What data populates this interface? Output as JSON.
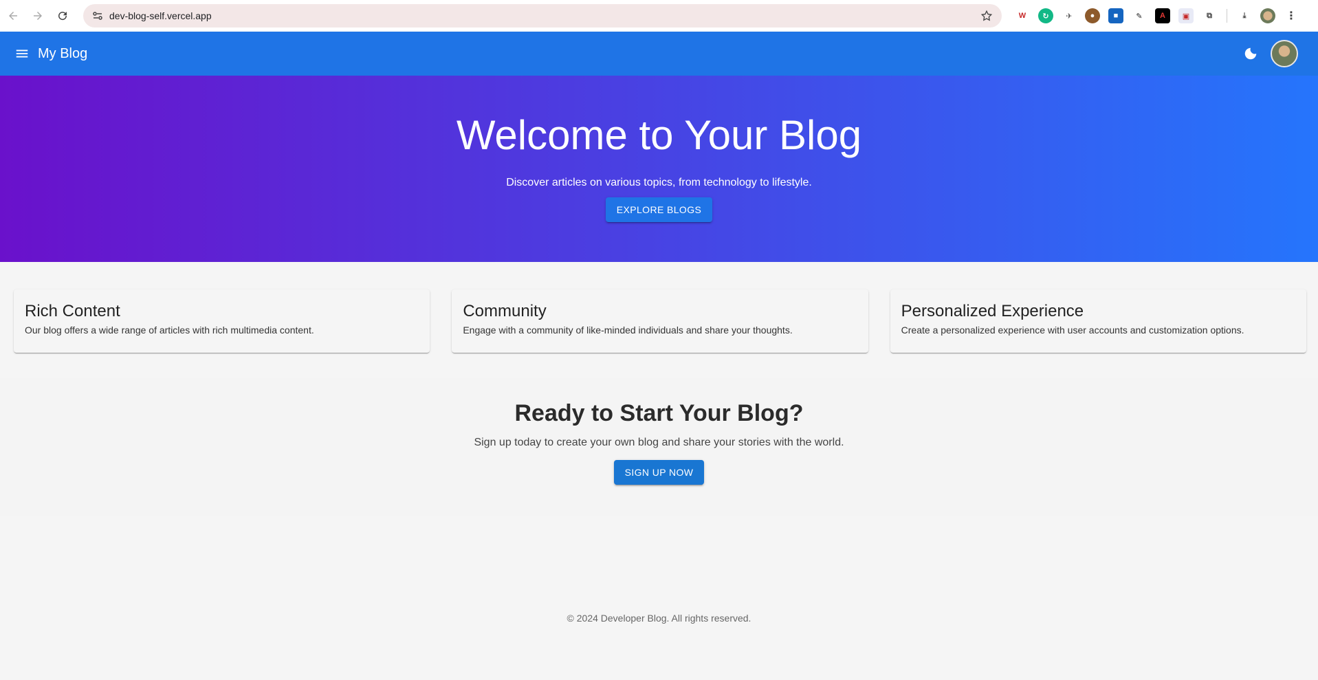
{
  "browser": {
    "url": "dev-blog-self.vercel.app"
  },
  "app_bar": {
    "title": "My Blog"
  },
  "hero": {
    "title": "Welcome to Your Blog",
    "subtitle": "Discover articles on various topics, from technology to lifestyle.",
    "button_label": "EXPLORE BLOGS"
  },
  "features": [
    {
      "title": "Rich Content",
      "description": "Our blog offers a wide range of articles with rich multimedia content."
    },
    {
      "title": "Community",
      "description": "Engage with a community of like-minded individuals and share your thoughts."
    },
    {
      "title": "Personalized Experience",
      "description": "Create a personalized experience with user accounts and customization options."
    }
  ],
  "cta": {
    "title": "Ready to Start Your Blog?",
    "subtitle": "Sign up today to create your own blog and share your stories with the world.",
    "button_label": "SIGN UP NOW"
  },
  "footer": {
    "text": "© 2024 Developer Blog. All rights reserved."
  },
  "colors": {
    "app_bar": "#1f74e6",
    "hero_gradient_start": "#6a11cb",
    "hero_gradient_end": "#2575fc",
    "button": "#1976d2"
  },
  "icons": [
    "back-icon",
    "forward-icon",
    "reload-icon",
    "site-info-icon",
    "star-icon",
    "menu-icon",
    "dark-mode-icon",
    "download-icon",
    "extensions-icon",
    "more-icon"
  ]
}
